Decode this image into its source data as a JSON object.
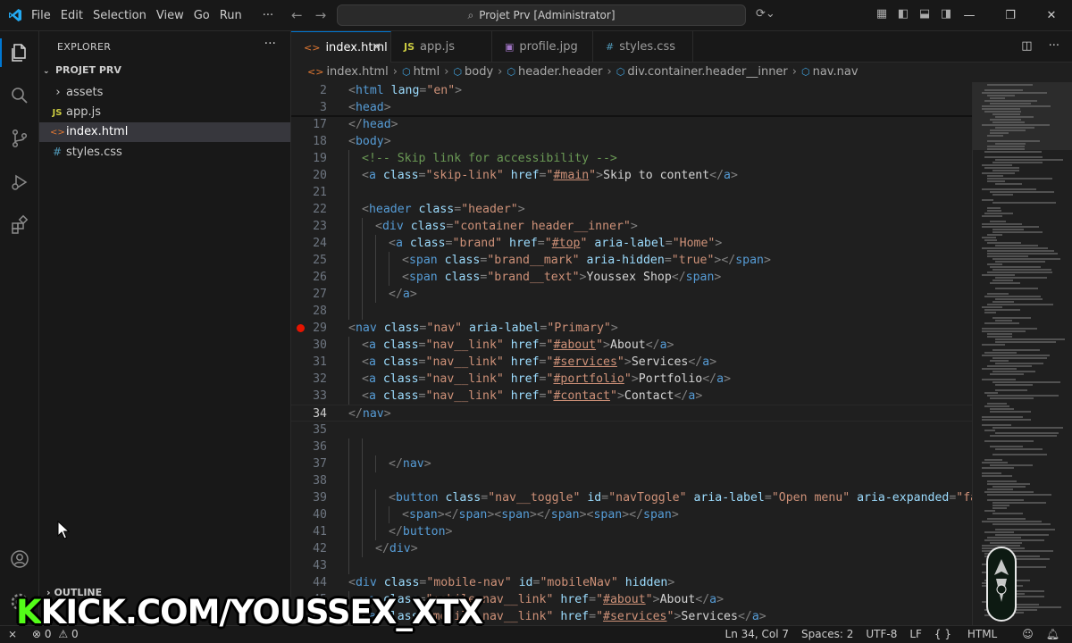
{
  "titlebar": {
    "menu": [
      "File",
      "Edit",
      "Selection",
      "View",
      "Go",
      "Run",
      "···"
    ],
    "search_text": "Projet Prv [Administrator]"
  },
  "sidebar": {
    "header": "EXPLORER",
    "more": "···",
    "project": "PROJET PRV",
    "items": [
      {
        "icon": "›",
        "label": "assets",
        "type": "folder"
      },
      {
        "icon": "JS",
        "label": "app.js",
        "type": "file"
      },
      {
        "icon": "<>",
        "label": "index.html",
        "type": "file",
        "selected": true
      },
      {
        "icon": "#",
        "label": "styles.css",
        "type": "file"
      }
    ],
    "outline": "OUTLINE"
  },
  "tabs": [
    {
      "icon": "<>",
      "label": "index.html",
      "active": true,
      "close": "✕"
    },
    {
      "icon": "JS",
      "label": "app.js"
    },
    {
      "icon": "▣",
      "label": "profile.jpg"
    },
    {
      "icon": "#",
      "label": "styles.css"
    }
  ],
  "breadcrumb": [
    "index.html",
    "html",
    "body",
    "header.header",
    "div.container.header__inner",
    "nav.nav"
  ],
  "code": {
    "current_line": "34",
    "breakpoint_line": "29",
    "lines": [
      {
        "n": "2",
        "indent": 0,
        "tokens": [
          [
            "brk",
            "<"
          ],
          [
            "tag",
            "html"
          ],
          [
            "attr",
            " lang"
          ],
          [
            "brk",
            "="
          ],
          [
            "val",
            "\"en\""
          ],
          [
            "brk",
            ">"
          ]
        ]
      },
      {
        "n": "3",
        "indent": 0,
        "tokens": [
          [
            "brk",
            "<"
          ],
          [
            "tag",
            "head"
          ],
          [
            "brk",
            ">"
          ]
        ]
      },
      {
        "n": "17",
        "indent": 0,
        "tokens": [
          [
            "brk",
            "</"
          ],
          [
            "tag",
            "head"
          ],
          [
            "brk",
            ">"
          ]
        ]
      },
      {
        "n": "18",
        "indent": 0,
        "tokens": [
          [
            "brk",
            "<"
          ],
          [
            "tag",
            "body"
          ],
          [
            "brk",
            ">"
          ]
        ]
      },
      {
        "n": "19",
        "indent": 1,
        "tokens": [
          [
            "com",
            "<!-- Skip link for accessibility -->"
          ]
        ]
      },
      {
        "n": "20",
        "indent": 1,
        "tokens": [
          [
            "brk",
            "<"
          ],
          [
            "tag",
            "a"
          ],
          [
            "attr",
            " class"
          ],
          [
            "brk",
            "="
          ],
          [
            "val",
            "\"skip-link\""
          ],
          [
            "attr",
            " href"
          ],
          [
            "brk",
            "="
          ],
          [
            "val",
            "\""
          ],
          [
            "link",
            "#main"
          ],
          [
            "val",
            "\""
          ],
          [
            "brk",
            ">"
          ],
          [
            "txt",
            "Skip to content"
          ],
          [
            "brk",
            "</"
          ],
          [
            "tag",
            "a"
          ],
          [
            "brk",
            ">"
          ]
        ]
      },
      {
        "n": "21",
        "indent": 1,
        "tokens": []
      },
      {
        "n": "22",
        "indent": 1,
        "tokens": [
          [
            "brk",
            "<"
          ],
          [
            "tag",
            "header"
          ],
          [
            "attr",
            " class"
          ],
          [
            "brk",
            "="
          ],
          [
            "val",
            "\"header\""
          ],
          [
            "brk",
            ">"
          ]
        ]
      },
      {
        "n": "23",
        "indent": 2,
        "tokens": [
          [
            "brk",
            "<"
          ],
          [
            "tag",
            "div"
          ],
          [
            "attr",
            " class"
          ],
          [
            "brk",
            "="
          ],
          [
            "val",
            "\"container header__inner\""
          ],
          [
            "brk",
            ">"
          ]
        ]
      },
      {
        "n": "24",
        "indent": 3,
        "tokens": [
          [
            "brk",
            "<"
          ],
          [
            "tag",
            "a"
          ],
          [
            "attr",
            " class"
          ],
          [
            "brk",
            "="
          ],
          [
            "val",
            "\"brand\""
          ],
          [
            "attr",
            " href"
          ],
          [
            "brk",
            "="
          ],
          [
            "val",
            "\""
          ],
          [
            "link",
            "#top"
          ],
          [
            "val",
            "\""
          ],
          [
            "attr",
            " aria-label"
          ],
          [
            "brk",
            "="
          ],
          [
            "val",
            "\"Home\""
          ],
          [
            "brk",
            ">"
          ]
        ]
      },
      {
        "n": "25",
        "indent": 4,
        "tokens": [
          [
            "brk",
            "<"
          ],
          [
            "tag",
            "span"
          ],
          [
            "attr",
            " class"
          ],
          [
            "brk",
            "="
          ],
          [
            "val",
            "\"brand__mark\""
          ],
          [
            "attr",
            " aria-hidden"
          ],
          [
            "brk",
            "="
          ],
          [
            "val",
            "\"true\""
          ],
          [
            "brk",
            "></"
          ],
          [
            "tag",
            "span"
          ],
          [
            "brk",
            ">"
          ]
        ]
      },
      {
        "n": "26",
        "indent": 4,
        "tokens": [
          [
            "brk",
            "<"
          ],
          [
            "tag",
            "span"
          ],
          [
            "attr",
            " class"
          ],
          [
            "brk",
            "="
          ],
          [
            "val",
            "\"brand__text\""
          ],
          [
            "brk",
            ">"
          ],
          [
            "txt",
            "Youssex Shop"
          ],
          [
            "brk",
            "</"
          ],
          [
            "tag",
            "span"
          ],
          [
            "brk",
            ">"
          ]
        ]
      },
      {
        "n": "27",
        "indent": 3,
        "tokens": [
          [
            "brk",
            "</"
          ],
          [
            "tag",
            "a"
          ],
          [
            "brk",
            ">"
          ]
        ]
      },
      {
        "n": "28",
        "indent": 2,
        "tokens": []
      },
      {
        "n": "29",
        "indent": 0,
        "tokens": [
          [
            "brk",
            "<"
          ],
          [
            "tag",
            "nav"
          ],
          [
            "attr",
            " class"
          ],
          [
            "brk",
            "="
          ],
          [
            "val",
            "\"nav\""
          ],
          [
            "attr",
            " aria-label"
          ],
          [
            "brk",
            "="
          ],
          [
            "val",
            "\"Primary\""
          ],
          [
            "brk",
            ">"
          ]
        ]
      },
      {
        "n": "30",
        "indent": 1,
        "tokens": [
          [
            "brk",
            "<"
          ],
          [
            "tag",
            "a"
          ],
          [
            "attr",
            " class"
          ],
          [
            "brk",
            "="
          ],
          [
            "val",
            "\"nav__link\""
          ],
          [
            "attr",
            " href"
          ],
          [
            "brk",
            "="
          ],
          [
            "val",
            "\""
          ],
          [
            "link",
            "#about"
          ],
          [
            "val",
            "\""
          ],
          [
            "brk",
            ">"
          ],
          [
            "txt",
            "About"
          ],
          [
            "brk",
            "</"
          ],
          [
            "tag",
            "a"
          ],
          [
            "brk",
            ">"
          ]
        ]
      },
      {
        "n": "31",
        "indent": 1,
        "tokens": [
          [
            "brk",
            "<"
          ],
          [
            "tag",
            "a"
          ],
          [
            "attr",
            " class"
          ],
          [
            "brk",
            "="
          ],
          [
            "val",
            "\"nav__link\""
          ],
          [
            "attr",
            " href"
          ],
          [
            "brk",
            "="
          ],
          [
            "val",
            "\""
          ],
          [
            "link",
            "#services"
          ],
          [
            "val",
            "\""
          ],
          [
            "brk",
            ">"
          ],
          [
            "txt",
            "Services"
          ],
          [
            "brk",
            "</"
          ],
          [
            "tag",
            "a"
          ],
          [
            "brk",
            ">"
          ]
        ]
      },
      {
        "n": "32",
        "indent": 1,
        "tokens": [
          [
            "brk",
            "<"
          ],
          [
            "tag",
            "a"
          ],
          [
            "attr",
            " class"
          ],
          [
            "brk",
            "="
          ],
          [
            "val",
            "\"nav__link\""
          ],
          [
            "attr",
            " href"
          ],
          [
            "brk",
            "="
          ],
          [
            "val",
            "\""
          ],
          [
            "link",
            "#portfolio"
          ],
          [
            "val",
            "\""
          ],
          [
            "brk",
            ">"
          ],
          [
            "txt",
            "Portfolio"
          ],
          [
            "brk",
            "</"
          ],
          [
            "tag",
            "a"
          ],
          [
            "brk",
            ">"
          ]
        ]
      },
      {
        "n": "33",
        "indent": 1,
        "tokens": [
          [
            "brk",
            "<"
          ],
          [
            "tag",
            "a"
          ],
          [
            "attr",
            " class"
          ],
          [
            "brk",
            "="
          ],
          [
            "val",
            "\"nav__link\""
          ],
          [
            "attr",
            " href"
          ],
          [
            "brk",
            "="
          ],
          [
            "val",
            "\""
          ],
          [
            "link",
            "#contact"
          ],
          [
            "val",
            "\""
          ],
          [
            "brk",
            ">"
          ],
          [
            "txt",
            "Contact"
          ],
          [
            "brk",
            "</"
          ],
          [
            "tag",
            "a"
          ],
          [
            "brk",
            ">"
          ]
        ]
      },
      {
        "n": "34",
        "indent": 0,
        "tokens": [
          [
            "brk",
            "</"
          ],
          [
            "tag",
            "nav"
          ],
          [
            "brk",
            ">"
          ]
        ]
      },
      {
        "n": "35",
        "indent": 0,
        "tokens": []
      },
      {
        "n": "36",
        "indent": 2,
        "tokens": []
      },
      {
        "n": "37",
        "indent": 3,
        "tokens": [
          [
            "brk",
            "</"
          ],
          [
            "tag",
            "nav"
          ],
          [
            "brk",
            ">"
          ]
        ]
      },
      {
        "n": "38",
        "indent": 2,
        "tokens": []
      },
      {
        "n": "39",
        "indent": 3,
        "tokens": [
          [
            "brk",
            "<"
          ],
          [
            "tag",
            "button"
          ],
          [
            "attr",
            " class"
          ],
          [
            "brk",
            "="
          ],
          [
            "val",
            "\"nav__toggle\""
          ],
          [
            "attr",
            " id"
          ],
          [
            "brk",
            "="
          ],
          [
            "val",
            "\"navToggle\""
          ],
          [
            "attr",
            " aria-label"
          ],
          [
            "brk",
            "="
          ],
          [
            "val",
            "\"Open menu\""
          ],
          [
            "attr",
            " aria-expanded"
          ],
          [
            "brk",
            "="
          ],
          [
            "val",
            "\"false\""
          ],
          [
            "brk",
            ">"
          ]
        ]
      },
      {
        "n": "40",
        "indent": 4,
        "tokens": [
          [
            "brk",
            "<"
          ],
          [
            "tag",
            "span"
          ],
          [
            "brk",
            "></"
          ],
          [
            "tag",
            "span"
          ],
          [
            "brk",
            "><"
          ],
          [
            "tag",
            "span"
          ],
          [
            "brk",
            "></"
          ],
          [
            "tag",
            "span"
          ],
          [
            "brk",
            "><"
          ],
          [
            "tag",
            "span"
          ],
          [
            "brk",
            "></"
          ],
          [
            "tag",
            "span"
          ],
          [
            "brk",
            ">"
          ]
        ]
      },
      {
        "n": "41",
        "indent": 3,
        "tokens": [
          [
            "brk",
            "</"
          ],
          [
            "tag",
            "button"
          ],
          [
            "brk",
            ">"
          ]
        ]
      },
      {
        "n": "42",
        "indent": 2,
        "tokens": [
          [
            "brk",
            "</"
          ],
          [
            "tag",
            "div"
          ],
          [
            "brk",
            ">"
          ]
        ]
      },
      {
        "n": "43",
        "indent": 1,
        "tokens": []
      },
      {
        "n": "44",
        "indent": 0,
        "tokens": [
          [
            "brk",
            "<"
          ],
          [
            "tag",
            "div"
          ],
          [
            "attr",
            " class"
          ],
          [
            "brk",
            "="
          ],
          [
            "val",
            "\"mobile-nav\""
          ],
          [
            "attr",
            " id"
          ],
          [
            "brk",
            "="
          ],
          [
            "val",
            "\"mobileNav\""
          ],
          [
            "attr",
            " hidden"
          ],
          [
            "brk",
            ">"
          ]
        ]
      },
      {
        "n": "45",
        "indent": 1,
        "tokens": [
          [
            "brk",
            "<"
          ],
          [
            "tag",
            "a"
          ],
          [
            "attr",
            " class"
          ],
          [
            "brk",
            "="
          ],
          [
            "val",
            "\"mobile-nav__link\""
          ],
          [
            "attr",
            " href"
          ],
          [
            "brk",
            "="
          ],
          [
            "val",
            "\""
          ],
          [
            "link",
            "#about"
          ],
          [
            "val",
            "\""
          ],
          [
            "brk",
            ">"
          ],
          [
            "txt",
            "About"
          ],
          [
            "brk",
            "</"
          ],
          [
            "tag",
            "a"
          ],
          [
            "brk",
            ">"
          ]
        ]
      },
      {
        "n": "46",
        "indent": 1,
        "tokens": [
          [
            "brk",
            "<"
          ],
          [
            "tag",
            "a"
          ],
          [
            "attr",
            " class"
          ],
          [
            "brk",
            "="
          ],
          [
            "val",
            "\"mobile-nav__link\""
          ],
          [
            "attr",
            " href"
          ],
          [
            "brk",
            "="
          ],
          [
            "val",
            "\""
          ],
          [
            "link",
            "#services"
          ],
          [
            "val",
            "\""
          ],
          [
            "brk",
            ">"
          ],
          [
            "txt",
            "Services"
          ],
          [
            "brk",
            "</"
          ],
          [
            "tag",
            "a"
          ],
          [
            "brk",
            ">"
          ]
        ]
      }
    ]
  },
  "statusbar": {
    "errors": "0",
    "warnings": "0",
    "position": "Ln 34, Col 7",
    "spaces": "Spaces: 2",
    "encoding": "UTF-8",
    "eol": "LF",
    "braces": "{ }",
    "language": "HTML"
  },
  "watermark": {
    "k": "K",
    "text": "KICK.COM/YOUSSEX_XTX"
  },
  "colors": {
    "accent": "#0078d4",
    "breakpoint": "#e51400",
    "tag": "#569cd6",
    "attr": "#9cdcfe",
    "value": "#ce9178",
    "comment": "#6a9955",
    "kick": "#53fc18"
  }
}
